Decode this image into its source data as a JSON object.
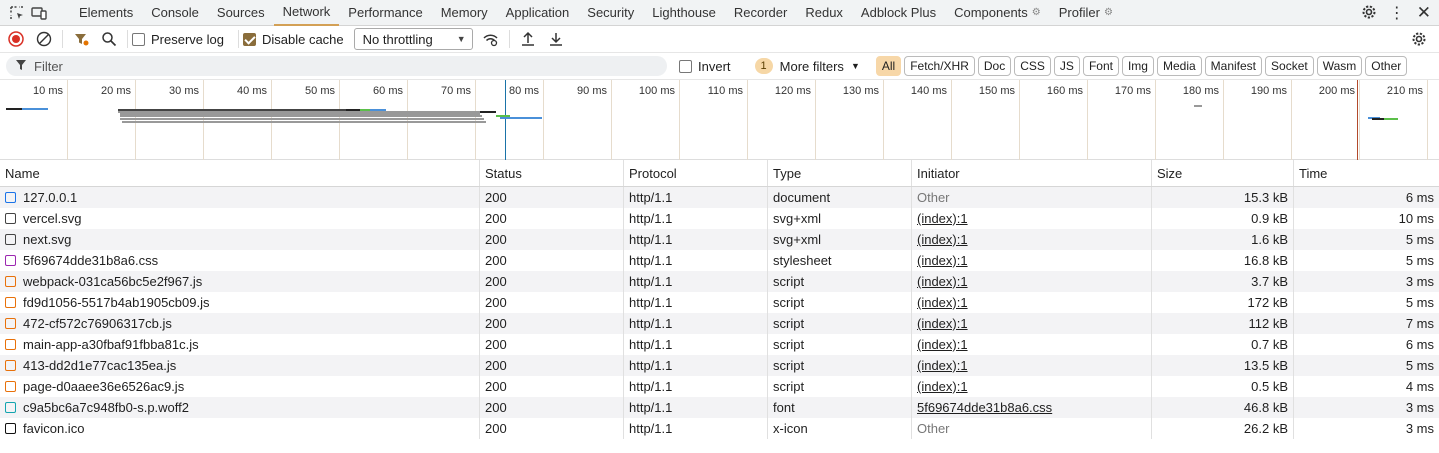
{
  "tabs": [
    {
      "label": "Elements",
      "gear": false
    },
    {
      "label": "Console",
      "gear": false
    },
    {
      "label": "Sources",
      "gear": false
    },
    {
      "label": "Network",
      "gear": false,
      "active": true
    },
    {
      "label": "Performance",
      "gear": false
    },
    {
      "label": "Memory",
      "gear": false
    },
    {
      "label": "Application",
      "gear": false
    },
    {
      "label": "Security",
      "gear": false
    },
    {
      "label": "Lighthouse",
      "gear": false
    },
    {
      "label": "Recorder",
      "gear": false
    },
    {
      "label": "Redux",
      "gear": false
    },
    {
      "label": "Adblock Plus",
      "gear": false
    },
    {
      "label": "Components",
      "gear": true
    },
    {
      "label": "Profiler",
      "gear": true
    }
  ],
  "toolbar": {
    "preserve_log": "Preserve log",
    "disable_cache": "Disable cache",
    "throttling": "No throttling"
  },
  "filter": {
    "placeholder": "Filter",
    "invert": "Invert",
    "more_filters_count": "1",
    "more_filters": "More filters",
    "types": [
      "All",
      "Fetch/XHR",
      "Doc",
      "CSS",
      "JS",
      "Font",
      "Img",
      "Media",
      "Manifest",
      "Socket",
      "Wasm",
      "Other"
    ]
  },
  "timeline": {
    "ticks": [
      "10 ms",
      "20 ms",
      "30 ms",
      "40 ms",
      "50 ms",
      "60 ms",
      "70 ms",
      "80 ms",
      "90 ms",
      "100 ms",
      "110 ms",
      "120 ms",
      "130 ms",
      "140 ms",
      "150 ms",
      "160 ms",
      "170 ms",
      "180 ms",
      "190 ms",
      "200 ms",
      "210 ms"
    ]
  },
  "columns": {
    "name": "Name",
    "status": "Status",
    "protocol": "Protocol",
    "type": "Type",
    "initiator": "Initiator",
    "size": "Size",
    "time": "Time"
  },
  "rows": [
    {
      "name": "127.0.0.1",
      "icon": "document-icon",
      "color": "#1a73e8",
      "status": "200",
      "protocol": "http/1.1",
      "type": "document",
      "initiator": "Other",
      "initiator_link": false,
      "size": "15.3 kB",
      "time": "6 ms"
    },
    {
      "name": "vercel.svg",
      "icon": "svg-icon",
      "color": "#444444",
      "status": "200",
      "protocol": "http/1.1",
      "type": "svg+xml",
      "initiator": "(index):1",
      "initiator_link": true,
      "size": "0.9 kB",
      "time": "10 ms"
    },
    {
      "name": "next.svg",
      "icon": "svg-icon",
      "color": "#444444",
      "status": "200",
      "protocol": "http/1.1",
      "type": "svg+xml",
      "initiator": "(index):1",
      "initiator_link": true,
      "size": "1.6 kB",
      "time": "5 ms"
    },
    {
      "name": "5f69674dde31b8a6.css",
      "icon": "stylesheet-icon",
      "color": "#9c27b0",
      "status": "200",
      "protocol": "http/1.1",
      "type": "stylesheet",
      "initiator": "(index):1",
      "initiator_link": true,
      "size": "16.8 kB",
      "time": "5 ms"
    },
    {
      "name": "webpack-031ca56bc5e2f967.js",
      "icon": "script-icon",
      "color": "#e8710a",
      "status": "200",
      "protocol": "http/1.1",
      "type": "script",
      "initiator": "(index):1",
      "initiator_link": true,
      "size": "3.7 kB",
      "time": "3 ms"
    },
    {
      "name": "fd9d1056-5517b4ab1905cb09.js",
      "icon": "script-icon",
      "color": "#e8710a",
      "status": "200",
      "protocol": "http/1.1",
      "type": "script",
      "initiator": "(index):1",
      "initiator_link": true,
      "size": "172 kB",
      "time": "5 ms"
    },
    {
      "name": "472-cf572c76906317cb.js",
      "icon": "script-icon",
      "color": "#e8710a",
      "status": "200",
      "protocol": "http/1.1",
      "type": "script",
      "initiator": "(index):1",
      "initiator_link": true,
      "size": "112 kB",
      "time": "7 ms"
    },
    {
      "name": "main-app-a30fbaf91fbba81c.js",
      "icon": "script-icon",
      "color": "#e8710a",
      "status": "200",
      "protocol": "http/1.1",
      "type": "script",
      "initiator": "(index):1",
      "initiator_link": true,
      "size": "0.7 kB",
      "time": "6 ms"
    },
    {
      "name": "413-dd2d1e77cac135ea.js",
      "icon": "script-icon",
      "color": "#e8710a",
      "status": "200",
      "protocol": "http/1.1",
      "type": "script",
      "initiator": "(index):1",
      "initiator_link": true,
      "size": "13.5 kB",
      "time": "5 ms"
    },
    {
      "name": "page-d0aaee36e6526ac9.js",
      "icon": "script-icon",
      "color": "#e8710a",
      "status": "200",
      "protocol": "http/1.1",
      "type": "script",
      "initiator": "(index):1",
      "initiator_link": true,
      "size": "0.5 kB",
      "time": "4 ms"
    },
    {
      "name": "c9a5bc6a7c948fb0-s.p.woff2",
      "icon": "font-icon",
      "color": "#12a4af",
      "status": "200",
      "protocol": "http/1.1",
      "type": "font",
      "initiator": "5f69674dde31b8a6.css",
      "initiator_link": true,
      "size": "46.8 kB",
      "time": "3 ms"
    },
    {
      "name": "favicon.ico",
      "icon": "favicon-icon",
      "color": "#111111",
      "status": "200",
      "protocol": "http/1.1",
      "type": "x-icon",
      "initiator": "Other",
      "initiator_link": false,
      "size": "26.2 kB",
      "time": "3 ms"
    }
  ]
}
